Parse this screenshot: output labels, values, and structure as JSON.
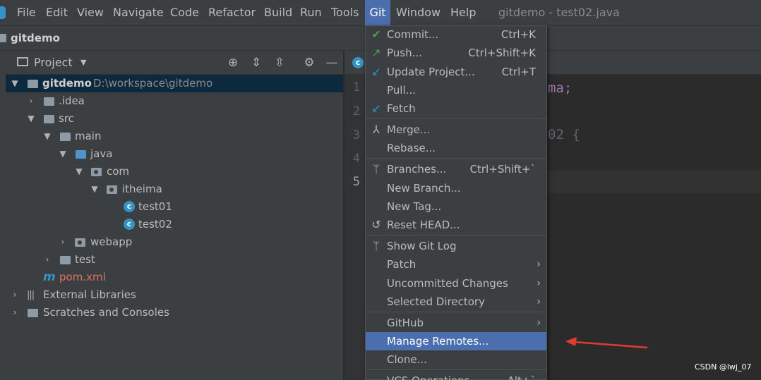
{
  "menubar": {
    "items": [
      "File",
      "Edit",
      "View",
      "Navigate",
      "Code",
      "Refactor",
      "Build",
      "Run",
      "Tools",
      "Git",
      "Window",
      "Help"
    ],
    "title": "gitdemo - test02.java"
  },
  "navbar": {
    "project": "gitdemo"
  },
  "project_panel": {
    "title": "Project",
    "tree": [
      {
        "label": "gitdemo",
        "path": "D:\\workspace\\gitdemo"
      },
      {
        "label": ".idea"
      },
      {
        "label": "src"
      },
      {
        "label": "main"
      },
      {
        "label": "java"
      },
      {
        "label": "com"
      },
      {
        "label": "itheima"
      },
      {
        "label": "test01"
      },
      {
        "label": "test02"
      },
      {
        "label": "webapp"
      },
      {
        "label": "test"
      },
      {
        "label": "pom.xml"
      },
      {
        "label": "External Libraries"
      },
      {
        "label": "Scratches and Consoles"
      }
    ]
  },
  "editor": {
    "line_numbers": [
      "1",
      "2",
      "3",
      "4",
      "5"
    ],
    "code_fragments": [
      "ma;",
      "02 {"
    ]
  },
  "git_menu": {
    "items": [
      {
        "label": "Commit...",
        "shortcut": "Ctrl+K",
        "icon": "check-icon"
      },
      {
        "label": "Push...",
        "shortcut": "Ctrl+Shift+K",
        "icon": "push-arrow-icon"
      },
      {
        "label": "Update Project...",
        "shortcut": "Ctrl+T",
        "icon": "update-arrow-icon"
      },
      {
        "label": "Pull...",
        "shortcut": "",
        "icon": ""
      },
      {
        "label": "Fetch",
        "shortcut": "",
        "icon": "fetch-icon"
      },
      {
        "label": "Merge...",
        "shortcut": "",
        "icon": "merge-icon"
      },
      {
        "label": "Rebase...",
        "shortcut": "",
        "icon": ""
      },
      {
        "label": "Branches...",
        "shortcut": "Ctrl+Shift+`",
        "icon": "branch-icon"
      },
      {
        "label": "New Branch...",
        "shortcut": "",
        "icon": ""
      },
      {
        "label": "New Tag...",
        "shortcut": "",
        "icon": ""
      },
      {
        "label": "Reset HEAD...",
        "shortcut": "",
        "icon": "reset-icon"
      },
      {
        "label": "Show Git Log",
        "shortcut": "",
        "icon": "git-log-icon"
      },
      {
        "label": "Patch",
        "shortcut": "",
        "icon": ""
      },
      {
        "label": "Uncommitted Changes",
        "shortcut": "",
        "icon": ""
      },
      {
        "label": "Selected Directory",
        "shortcut": "",
        "icon": ""
      },
      {
        "label": "GitHub",
        "shortcut": "",
        "icon": ""
      },
      {
        "label": "Manage Remotes...",
        "shortcut": "",
        "icon": ""
      },
      {
        "label": "Clone...",
        "shortcut": "",
        "icon": ""
      },
      {
        "label": "VCS Operations",
        "shortcut": "Alt+`",
        "icon": ""
      }
    ],
    "highlighted": "Manage Remotes..."
  },
  "watermark": "CSDN @lwj_07",
  "colors": {
    "accent": "#4b6eaf",
    "arrow": "#e03c31",
    "selection": "#0d293e"
  }
}
